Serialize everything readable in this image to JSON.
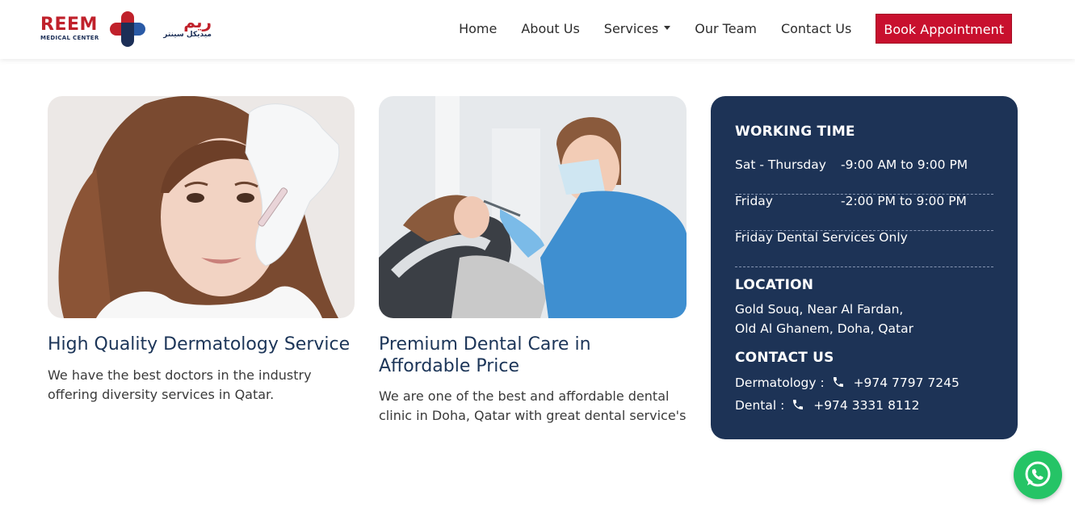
{
  "brand": {
    "name_en": "REEM",
    "subtitle_en": "MEDICAL CENTER",
    "name_ar": "ريم",
    "subtitle_ar": "ميديكل سينتر",
    "colors": {
      "red": "#c0212b",
      "navy": "#1c2f57",
      "blue": "#2a5aa6"
    }
  },
  "nav": {
    "items": [
      {
        "label": "Home"
      },
      {
        "label": "About Us"
      },
      {
        "label": "Services",
        "has_dropdown": true
      },
      {
        "label": "Our Team"
      },
      {
        "label": "Contact Us"
      }
    ],
    "cta_label": "Book Appointment",
    "cta_color": "#c8102e"
  },
  "cards": [
    {
      "image": "woman-dermatology-injection-photo",
      "title": "High Quality Dermatology Service",
      "text_line1": "We have the best doctors in the industry",
      "text_line2": "offering diversity services in Qatar."
    },
    {
      "image": "dentist-treating-patient-photo",
      "title_line1": "Premium Dental Care in",
      "title_line2": "Affordable Price",
      "text_line1": "We are one of the best and affordable dental",
      "text_line2": "clinic in Doha, Qatar with great dental service's"
    }
  ],
  "info": {
    "working_title": "WORKING TIME",
    "hours": [
      {
        "day": "Sat - Thursday",
        "time": "-9:00 AM to 9:00 PM"
      },
      {
        "day": "Friday",
        "time": "-2:00 PM to 9:00 PM"
      }
    ],
    "note": "Friday Dental Services Only",
    "location_title": "LOCATION",
    "address_line1": "Gold Souq, Near Al Fardan,",
    "address_line2": "Old Al Ghanem, Doha, Qatar",
    "contact_title": "CONTACT US",
    "contacts": [
      {
        "label": "Dermatology :",
        "phone": "+974 7797 7245"
      },
      {
        "label": "Dental :",
        "phone": "+974 3331 8112"
      }
    ],
    "panel_color": "#1d3356"
  },
  "whatsapp": {
    "icon": "whatsapp-icon",
    "color": "#25c466"
  }
}
